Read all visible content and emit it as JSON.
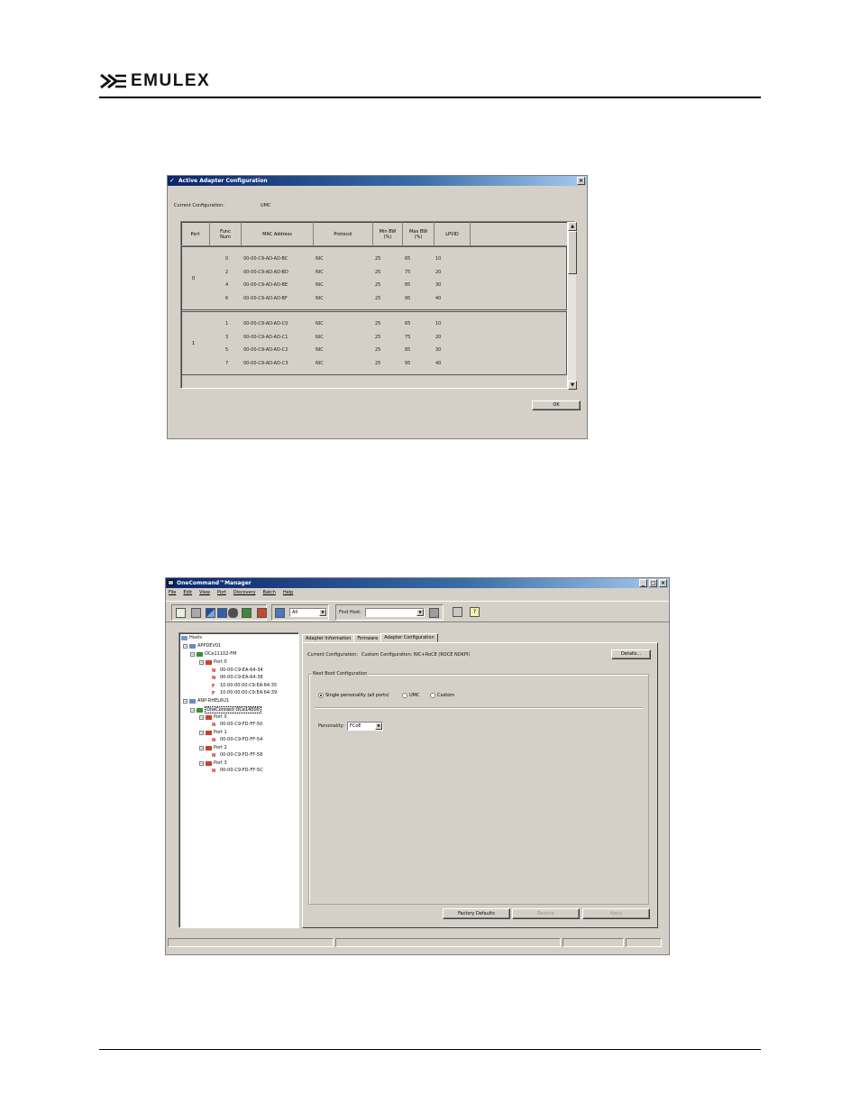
{
  "header": {
    "logo_text": "EMULEX"
  },
  "aac_window": {
    "title": "Active Adapter Configuration",
    "close_glyph": "×",
    "current_config_label": "Current Configuration:",
    "current_config_value": "UMC",
    "columns": [
      "Port",
      "Func Num",
      "MAC Address",
      "Protocol",
      "Min BW (%)",
      "Max BW (%)",
      "LPVID"
    ],
    "ports": [
      {
        "port": "0",
        "rows": [
          [
            "0",
            "00-00-C9-AD-AD-BC",
            "NIC",
            "25",
            "65",
            "10"
          ],
          [
            "2",
            "00-00-C9-AD-AD-BD",
            "NIC",
            "25",
            "75",
            "20"
          ],
          [
            "4",
            "00-00-C9-AD-AD-BE",
            "NIC",
            "25",
            "85",
            "30"
          ],
          [
            "6",
            "00-00-C9-AD-AD-BF",
            "NIC",
            "25",
            "95",
            "40"
          ]
        ]
      },
      {
        "port": "1",
        "rows": [
          [
            "1",
            "00-00-C9-AD-AD-C0",
            "NIC",
            "25",
            "65",
            "10"
          ],
          [
            "3",
            "00-00-C9-AD-AD-C1",
            "NIC",
            "25",
            "75",
            "20"
          ],
          [
            "5",
            "00-00-C9-AD-AD-C2",
            "NIC",
            "25",
            "85",
            "30"
          ],
          [
            "7",
            "00-00-C9-AD-AD-C3",
            "NIC",
            "25",
            "95",
            "40"
          ]
        ]
      }
    ],
    "ok_label": "OK"
  },
  "ocm_window": {
    "title": "OneCommand™Manager",
    "menu": [
      "File",
      "Edit",
      "View",
      "Port",
      "Discovery",
      "Batch",
      "Help"
    ],
    "filter_value": "All",
    "find_host_label": "Find Host:",
    "find_host_value": "",
    "tree": {
      "root": "Hosts",
      "host1": "APPDEV01",
      "host1_adapter": "OCe11102-FM",
      "host1_port0": "Port 0",
      "host1_macs": [
        "00-00-C9-EA-64-34",
        "00-00-C9-EA-64-38",
        "10:00:00:00:C9:EA:64:35",
        "10:00:00:00:C9:EA:64:39"
      ],
      "host2": "ANP-RHEL6U1",
      "host2_adapter": "OneConnect OCe14000",
      "ports": [
        {
          "label": "Port 0",
          "mac": "00-00-C9-FD-FF-50"
        },
        {
          "label": "Port 1",
          "mac": "00-00-C9-FD-FF-54"
        },
        {
          "label": "Port 2",
          "mac": "00-00-C9-FD-FF-58"
        },
        {
          "label": "Port 3",
          "mac": "00-00-C9-FD-FF-5C"
        }
      ]
    },
    "tabs": [
      "Adapter Information",
      "Firmware",
      "Adapter Configuration"
    ],
    "current_config_label": "Current Configuration:",
    "current_config_value": "Custom Configuration: NIC+RoCE (ROCE NDKPI)",
    "details_label": "Details...",
    "next_boot_label": "Next Boot Configuration",
    "radio_single": "Single personality (all ports)",
    "radio_umc": "UMC",
    "radio_custom": "Custom",
    "personality_label": "Personality:",
    "personality_value": "FCoE",
    "factory_defaults_label": "Factory Defaults",
    "restore_label": "Restore",
    "apply_label": "Apply"
  }
}
